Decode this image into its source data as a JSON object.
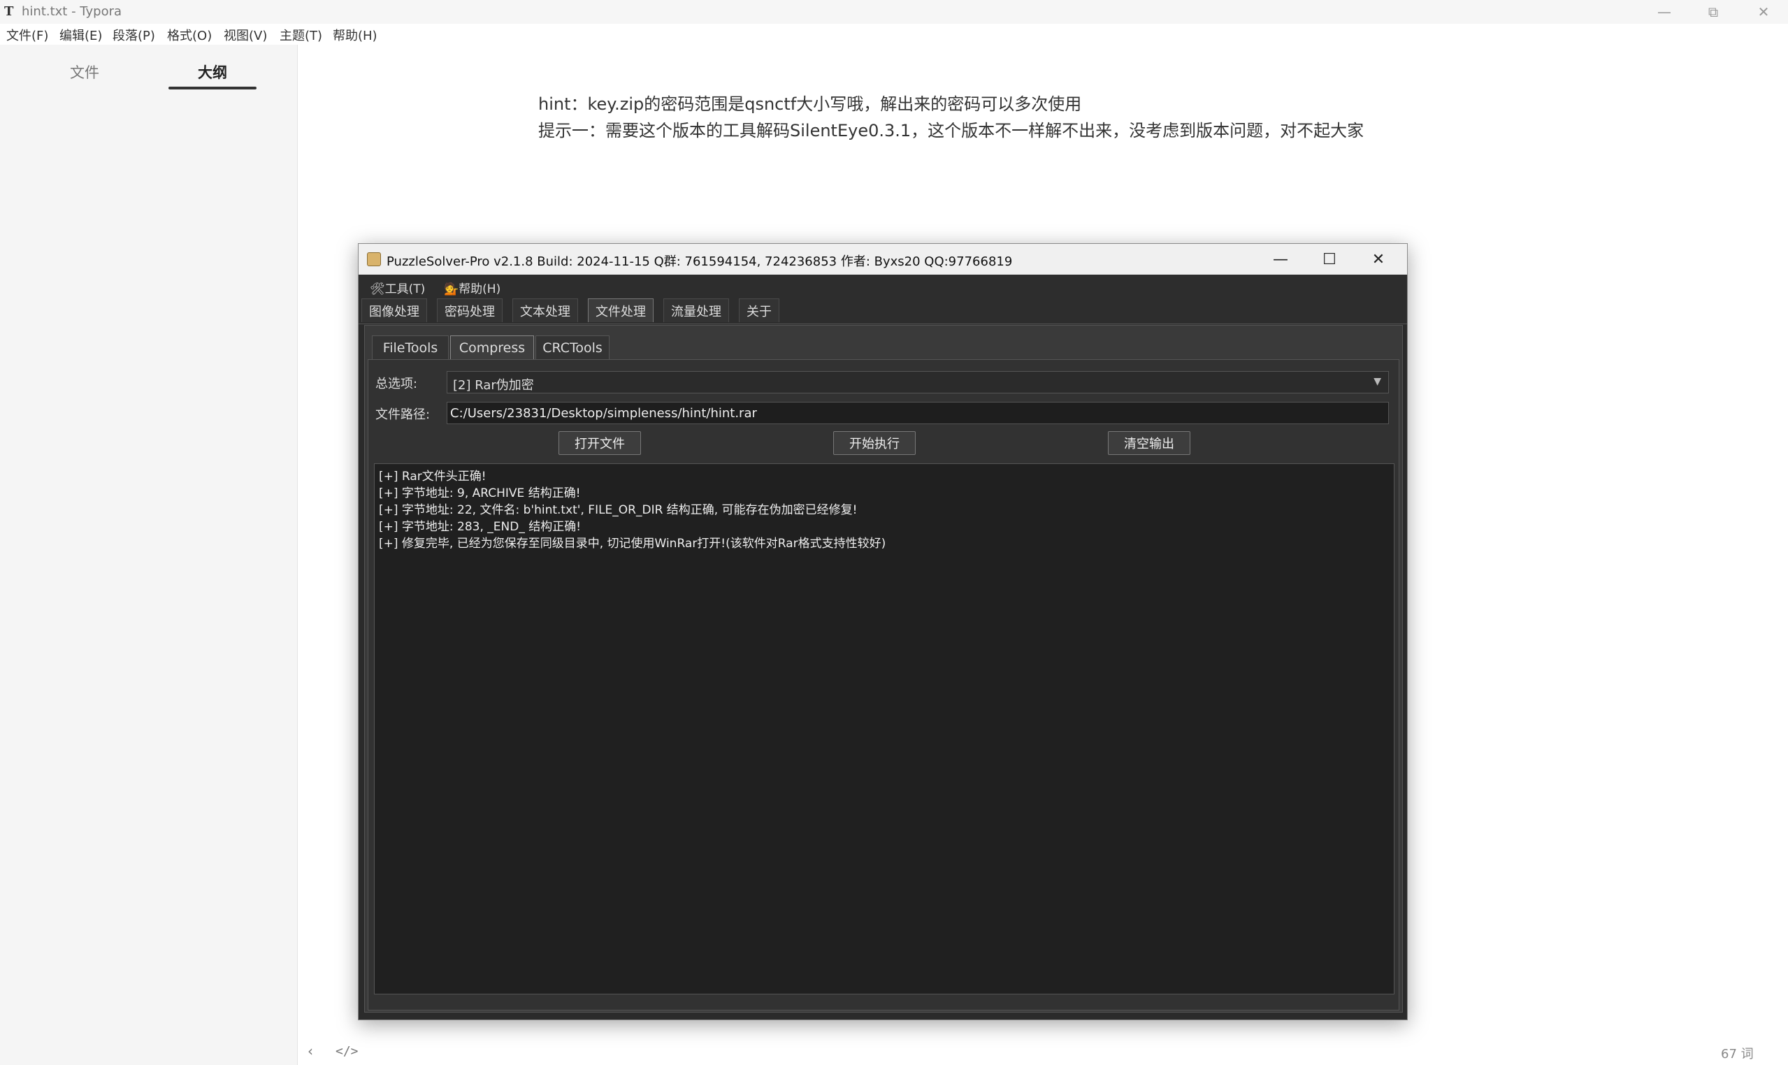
{
  "window": {
    "title": "hint.txt - Typora",
    "app_icon": "T"
  },
  "window_controls": [
    "—",
    "⧉",
    "✕"
  ],
  "menubar": [
    "文件(F)",
    "编辑(E)",
    "段落(P)",
    "格式(O)",
    "视图(V)",
    "主题(T)",
    "帮助(H)"
  ],
  "sidebar": {
    "tabs": [
      "文件",
      "大纲"
    ],
    "active_tab": "大纲"
  },
  "editor": {
    "lines": [
      "hint：key.zip的密码范围是qsnctf大小写哦，解出来的密码可以多次使用",
      "提示一：需要这个版本的工具解码SilentEye0.3.1，这个版本不一样解不出来，没考虑到版本问题，对不起大家"
    ]
  },
  "statusbar": {
    "back_icon": "‹",
    "source_icon": "</>",
    "word_count": "67 词"
  },
  "puzzlesolver": {
    "title": "PuzzleSolver-Pro v2.1.8  Build: 2024-11-15  Q群: 761594154, 724236853  作者: Byxs20  QQ:97766819",
    "controls": [
      "—",
      "☐",
      "✕"
    ],
    "menu": [
      "🛠工具(T)",
      "💁帮助(H)"
    ],
    "tabs": [
      "图像处理",
      "密码处理",
      "文本处理",
      "文件处理",
      "流量处理",
      "关于"
    ],
    "active_tab": "文件处理",
    "subtabs": [
      "FileTools",
      "Compress",
      "CRCTools"
    ],
    "active_subtab": "Compress",
    "option_label": "总选项:",
    "option_value": "[2] Rar伪加密",
    "path_label": "文件路径:",
    "path_value": "C:/Users/23831/Desktop/simpleness/hint/hint.rar",
    "buttons": [
      "打开文件",
      "开始执行",
      "清空输出"
    ],
    "output": [
      "[+] Rar文件头正确!",
      "[+] 字节地址: 9, ARCHIVE 结构正确!",
      "[+] 字节地址: 22, 文件名: b'hint.txt', FILE_OR_DIR 结构正确, 可能存在伪加密已经修复!",
      "[+] 字节地址: 283, _END_ 结构正确!",
      "[+] 修复完毕, 已经为您保存至同级目录中, 切记使用WinRar打开!(该软件对Rar格式支持性较好)"
    ]
  }
}
